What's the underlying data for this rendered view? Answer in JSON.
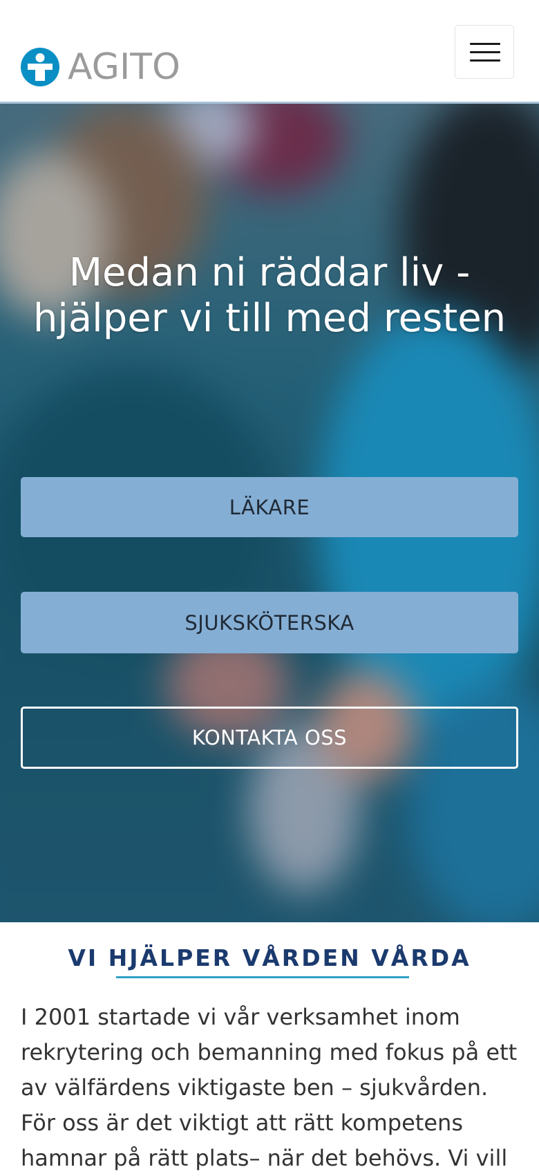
{
  "header": {
    "logo_text": "AGITO",
    "logo_icon": "medical-cross-icon",
    "menu_icon": "hamburger-menu-icon"
  },
  "hero": {
    "title": "Medan ni räddar liv - hjälper vi till med resten",
    "buttons": {
      "doctor_label": "LÄKARE",
      "nurse_label": "SJUKSKÖTERSKA",
      "contact_label": "KONTAKTA OSS"
    }
  },
  "intro": {
    "heading": "VI HJÄLPER VÅRDEN VÅRDA",
    "body": "I 2001 startade vi vår verksamhet inom rekrytering och bemanning med fokus på ett av välfärdens viktigaste ben – sjukvården. För oss är det viktigt att rätt kompetens hamnar på rätt plats– när det behövs. Vi vill"
  },
  "colors": {
    "brand_blue": "#0a8fc4",
    "logo_gray": "#9b9b9b",
    "button_blue": "#85aed4",
    "heading_navy": "#1b3a6e",
    "underline_teal": "#2f9fc4"
  }
}
